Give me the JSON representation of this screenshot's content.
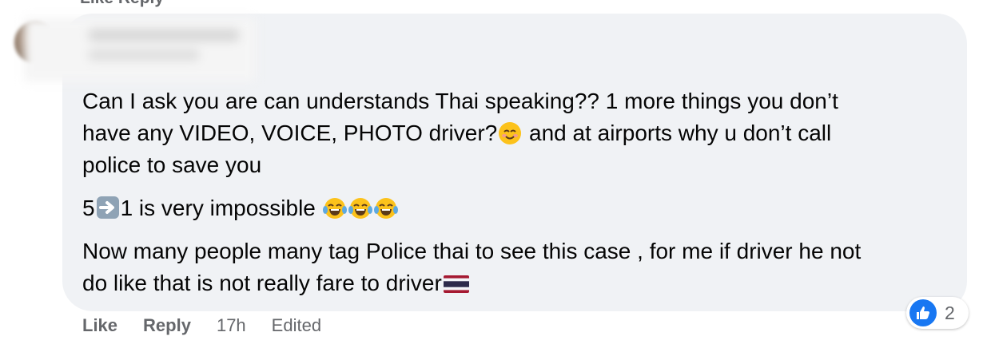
{
  "previous_comment": {
    "actions_partial": "Like   Reply"
  },
  "comment": {
    "author_name": "",
    "paragraphs": {
      "p1": {
        "line1": "Can I ask you are can understands Thai speaking?? 1 more things you don’t",
        "line2_a": "have any VIDEO, VOICE, PHOTO driver?",
        "line2_b": " and at airports why u don’t call",
        "line3": "police to save you"
      },
      "p2": {
        "a": "5",
        "b": "1 is very impossible "
      },
      "p3": {
        "line1": "Now many people many tag Police thai to see this case , for me if driver he not",
        "line2": "do like that is not really fare to driver"
      }
    },
    "icons": [
      "smiling-face-emoji",
      "right-arrow-emoji",
      "tears-of-joy-emoji",
      "thailand-flag-emoji"
    ],
    "reactions": {
      "count": "2",
      "type": "like"
    },
    "actions": {
      "like_label": "Like",
      "reply_label": "Reply",
      "time": "17h",
      "edited": "Edited"
    }
  },
  "colors": {
    "bubble": "#f0f2f5",
    "text": "#050505",
    "meta": "#65676b",
    "like_blue": "#1877f2"
  }
}
